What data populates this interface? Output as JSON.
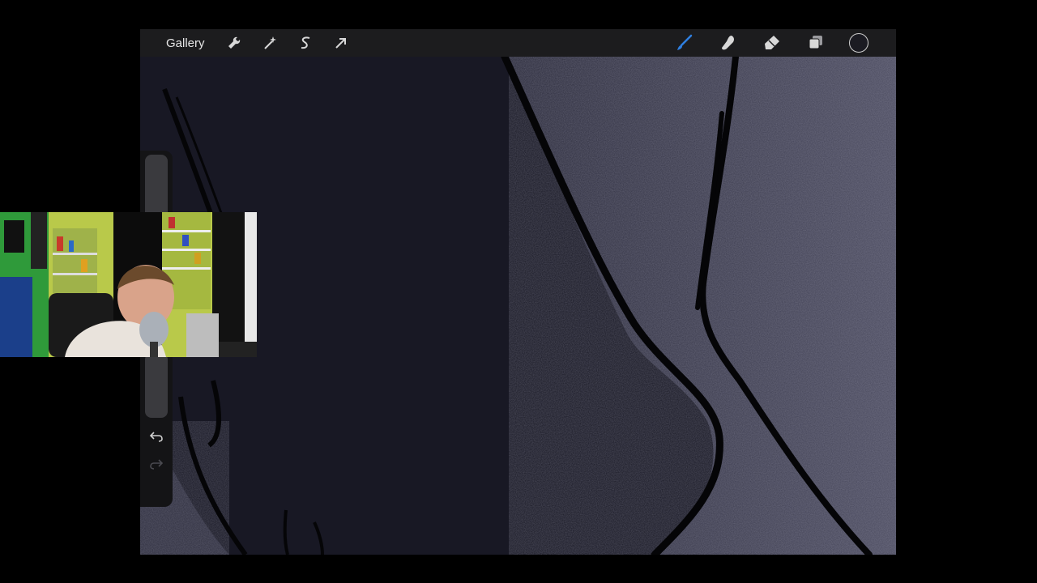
{
  "toolbar": {
    "gallery_label": "Gallery",
    "left_tools": [
      {
        "name": "actions",
        "icon": "wrench-icon"
      },
      {
        "name": "adjustments",
        "icon": "magic-wand-icon"
      },
      {
        "name": "selection",
        "icon": "selection-s-icon"
      },
      {
        "name": "transform",
        "icon": "arrow-cursor-icon"
      }
    ],
    "right_tools": [
      {
        "name": "brush",
        "icon": "brush-icon",
        "active": true,
        "color": "#2f7fe0"
      },
      {
        "name": "smudge",
        "icon": "smudge-finger-icon"
      },
      {
        "name": "eraser",
        "icon": "eraser-icon"
      },
      {
        "name": "layers",
        "icon": "layers-icon"
      }
    ],
    "current_color": "#1b1b22"
  },
  "sidebar": {
    "undo_icon": "undo-arrow-icon",
    "redo_icon": "redo-arrow-icon"
  },
  "colors": {
    "canvas_dark": "#181824",
    "canvas_texture": "#3b3a4e",
    "line": "#050507",
    "accent": "#2f7fe0"
  }
}
